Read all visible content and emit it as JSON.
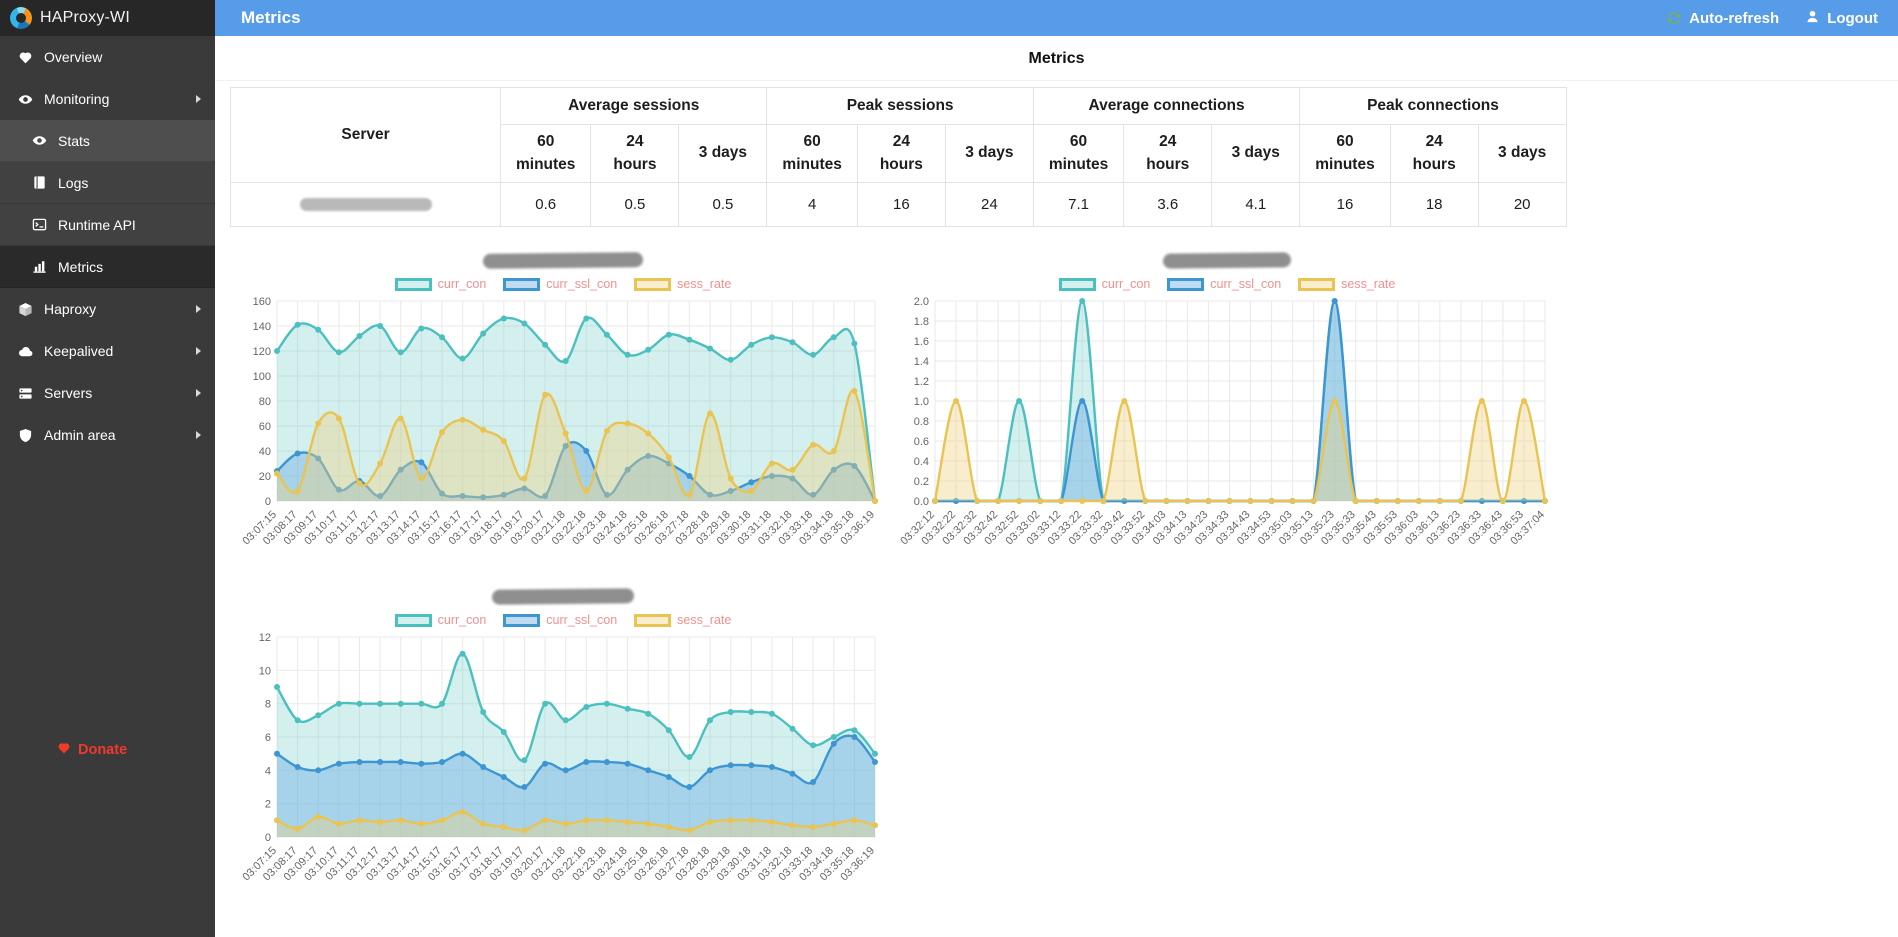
{
  "brand": {
    "name": "HAProxy-WI"
  },
  "header": {
    "title": "Metrics",
    "auto_refresh_label": "Auto-refresh",
    "logout_label": "Logout"
  },
  "sidebar": {
    "items": [
      {
        "label": "Overview"
      },
      {
        "label": "Monitoring"
      },
      {
        "label": "Stats"
      },
      {
        "label": "Logs"
      },
      {
        "label": "Runtime API"
      },
      {
        "label": "Metrics"
      },
      {
        "label": "Haproxy"
      },
      {
        "label": "Keepalived"
      },
      {
        "label": "Servers"
      },
      {
        "label": "Admin area"
      }
    ],
    "donate_label": "Donate"
  },
  "page": {
    "title": "Metrics"
  },
  "metrics_table": {
    "server_col": "Server",
    "groups": [
      {
        "label": "Average sessions"
      },
      {
        "label": "Peak sessions"
      },
      {
        "label": "Average connections"
      },
      {
        "label": "Peak connections"
      }
    ],
    "periods": [
      "60 minutes",
      "24 hours",
      "3 days"
    ],
    "rows": [
      {
        "server": "",
        "server_redacted": true,
        "values": [
          "0.6",
          "0.5",
          "0.5",
          "4",
          "16",
          "24",
          "7.1",
          "3.6",
          "4.1",
          "16",
          "18",
          "20"
        ]
      }
    ]
  },
  "colors": {
    "header_bg": "#579ce8",
    "accent_teal": "#4cbfbf",
    "accent_blue": "#3d96d2",
    "accent_yellow": "#e9c453",
    "legend_text": "#f28f8f",
    "donate_red": "#f0392b",
    "autorefresh_green": "#7cb342",
    "grid": "#e9e9e9",
    "axis_text": "#666666"
  },
  "chart_data": [
    {
      "type": "area",
      "title": "",
      "title_redacted": true,
      "ylim": [
        0,
        160
      ],
      "ytick": 20,
      "ydecimals": 0,
      "grid": true,
      "legend_position": "top",
      "x": [
        "03:07:15",
        "03:08:17",
        "03:09:17",
        "03:10:17",
        "03:11:17",
        "03:12:17",
        "03:13:17",
        "03:14:17",
        "03:15:17",
        "03:16:17",
        "03:17:17",
        "03:18:17",
        "03:19:17",
        "03:20:17",
        "03:21:18",
        "03:22:18",
        "03:23:18",
        "03:24:18",
        "03:25:18",
        "03:26:18",
        "03:27:18",
        "03:28:18",
        "03:29:18",
        "03:30:18",
        "03:31:18",
        "03:32:18",
        "03:33:18",
        "03:34:18",
        "03:35:18",
        "03:36:19"
      ],
      "series": [
        {
          "name": "curr_con",
          "color": "#4cbfbf",
          "fill": "rgba(133,211,205,0.35)",
          "values": [
            120,
            141,
            137,
            119,
            132,
            140,
            119,
            138,
            131,
            114,
            134,
            146,
            142,
            125,
            112,
            146,
            133,
            117,
            121,
            133,
            129,
            122,
            113,
            125,
            131,
            127,
            117,
            131,
            126,
            0
          ]
        },
        {
          "name": "curr_ssl_con",
          "color": "#3d96d2",
          "fill": "rgba(110,175,226,0.45)",
          "values": [
            24,
            38,
            34,
            9,
            16,
            4,
            25,
            31,
            6,
            4,
            3,
            5,
            10,
            4,
            44,
            40,
            5,
            25,
            36,
            30,
            20,
            5,
            8,
            15,
            20,
            18,
            5,
            25,
            28,
            0
          ]
        },
        {
          "name": "sess_rate",
          "color": "#e9c453",
          "fill": "rgba(238,210,130,0.4)",
          "values": [
            22,
            8,
            62,
            66,
            14,
            30,
            66,
            18,
            55,
            65,
            57,
            48,
            18,
            85,
            54,
            8,
            56,
            62,
            54,
            35,
            5,
            70,
            18,
            8,
            30,
            25,
            45,
            40,
            88,
            0
          ]
        }
      ]
    },
    {
      "type": "area",
      "title": "",
      "title_redacted": true,
      "ylim": [
        0,
        2
      ],
      "ytick": 0.2,
      "ydecimals": 1,
      "grid": true,
      "legend_position": "top",
      "x": [
        "03:32:12",
        "03:32:22",
        "03:32:32",
        "03:32:42",
        "03:32:52",
        "03:33:02",
        "03:33:12",
        "03:33:22",
        "03:33:32",
        "03:33:42",
        "03:33:52",
        "03:34:03",
        "03:34:13",
        "03:34:23",
        "03:34:33",
        "03:34:43",
        "03:34:53",
        "03:35:03",
        "03:35:13",
        "03:35:23",
        "03:35:33",
        "03:35:43",
        "03:35:53",
        "03:36:03",
        "03:36:13",
        "03:36:23",
        "03:36:33",
        "03:36:43",
        "03:36:53",
        "03:37:04"
      ],
      "series": [
        {
          "name": "curr_con",
          "color": "#4cbfbf",
          "fill": "rgba(133,211,205,0.35)",
          "values": [
            0,
            0,
            0,
            0,
            1,
            0,
            0,
            2,
            0,
            0,
            0,
            0,
            0,
            0,
            0,
            0,
            0,
            0,
            0,
            2,
            0,
            0,
            0,
            0,
            0,
            0,
            0,
            0,
            0,
            0
          ]
        },
        {
          "name": "curr_ssl_con",
          "color": "#3d96d2",
          "fill": "rgba(110,175,226,0.45)",
          "values": [
            0,
            0,
            0,
            0,
            0,
            0,
            0,
            1,
            0,
            0,
            0,
            0,
            0,
            0,
            0,
            0,
            0,
            0,
            0,
            2,
            0,
            0,
            0,
            0,
            0,
            0,
            0,
            0,
            0,
            0
          ]
        },
        {
          "name": "sess_rate",
          "color": "#e9c453",
          "fill": "rgba(238,210,130,0.4)",
          "values": [
            0,
            1,
            0,
            0,
            0,
            0,
            0,
            0,
            0,
            1,
            0,
            0,
            0,
            0,
            0,
            0,
            0,
            0,
            0,
            1,
            0,
            0,
            0,
            0,
            0,
            0,
            1,
            0,
            1,
            0
          ]
        }
      ]
    },
    {
      "type": "area",
      "title": "",
      "title_redacted": true,
      "ylim": [
        0,
        12
      ],
      "ytick": 2,
      "ydecimals": 0,
      "grid": true,
      "legend_position": "top",
      "x": [
        "03:07:15",
        "03:08:17",
        "03:09:17",
        "03:10:17",
        "03:11:17",
        "03:12:17",
        "03:13:17",
        "03:14:17",
        "03:15:17",
        "03:16:17",
        "03:17:17",
        "03:18:17",
        "03:19:17",
        "03:20:17",
        "03:21:18",
        "03:22:18",
        "03:23:18",
        "03:24:18",
        "03:25:18",
        "03:26:18",
        "03:27:18",
        "03:28:18",
        "03:29:18",
        "03:30:18",
        "03:31:18",
        "03:32:18",
        "03:33:18",
        "03:34:18",
        "03:35:18",
        "03:36:19"
      ],
      "series": [
        {
          "name": "curr_con",
          "color": "#4cbfbf",
          "fill": "rgba(133,211,205,0.35)",
          "values": [
            9,
            7,
            7.3,
            8,
            8,
            8,
            8,
            8,
            8,
            11,
            7.5,
            6.3,
            4.6,
            8,
            7,
            7.8,
            8,
            7.7,
            7.4,
            6.4,
            4.8,
            7,
            7.5,
            7.5,
            7.4,
            6.5,
            5.5,
            6,
            6.4,
            5
          ]
        },
        {
          "name": "curr_ssl_con",
          "color": "#3d96d2",
          "fill": "rgba(110,175,226,0.45)",
          "values": [
            5,
            4.2,
            4,
            4.4,
            4.5,
            4.5,
            4.5,
            4.4,
            4.5,
            5,
            4.2,
            3.6,
            3,
            4.4,
            4,
            4.5,
            4.5,
            4.4,
            4,
            3.6,
            3,
            4,
            4.3,
            4.3,
            4.2,
            3.8,
            3.3,
            5.6,
            6,
            4.5
          ]
        },
        {
          "name": "sess_rate",
          "color": "#e9c453",
          "fill": "rgba(238,210,130,0.4)",
          "values": [
            1,
            0.5,
            1.2,
            0.8,
            1,
            0.9,
            1,
            0.8,
            1,
            1.5,
            0.8,
            0.6,
            0.4,
            1,
            0.8,
            1,
            1,
            0.9,
            0.8,
            0.6,
            0.4,
            0.9,
            1,
            1,
            0.9,
            0.7,
            0.6,
            0.8,
            1,
            0.7
          ]
        }
      ]
    }
  ]
}
